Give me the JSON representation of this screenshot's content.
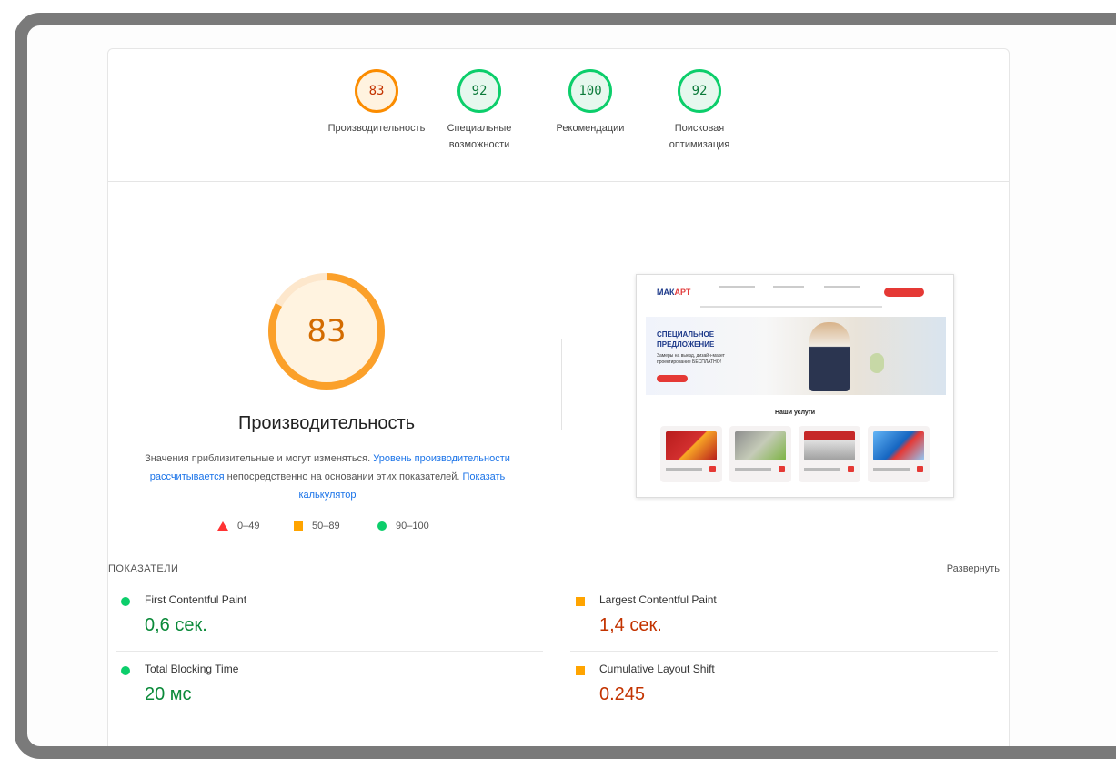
{
  "categories": [
    {
      "score": "83",
      "label": "Производительность",
      "status": "average"
    },
    {
      "score": "92",
      "label": "Специальные возможности",
      "status": "pass"
    },
    {
      "score": "100",
      "label": "Рекомендации",
      "status": "pass"
    },
    {
      "score": "92",
      "label": "Поисковая оптимизация",
      "status": "pass"
    }
  ],
  "performance": {
    "score": "83",
    "score_fraction": 0.83,
    "title": "Производительность",
    "desc_part1": "Значения приблизительные и могут изменяться. ",
    "desc_link1": "Уровень производительности рассчитывается",
    "desc_part2": " непосредственно на основании этих показателей. ",
    "desc_link2": "Показать калькулятор"
  },
  "legend": [
    {
      "range": "0–49",
      "shape": "triangle",
      "color": "#ff3333"
    },
    {
      "range": "50–89",
      "shape": "square",
      "color": "#ffa400"
    },
    {
      "range": "90–100",
      "shape": "circle",
      "color": "#0cce6b"
    }
  ],
  "thumbnail": {
    "logo_main": "МАК",
    "logo_accent": "АРТ",
    "hero_title": "СПЕЦИАЛЬНОЕ ПРЕДЛОЖЕНИЕ",
    "hero_sub": "Замеры на выезд, дизайн-макет проектирование БЕСПЛАТНО!",
    "services_title": "Наши услуги"
  },
  "metrics_header": {
    "title": "ПОКАЗАТЕЛИ",
    "expand": "Развернуть"
  },
  "metrics": [
    {
      "name": "First Contentful Paint",
      "value": "0,6 сек.",
      "status": "pass"
    },
    {
      "name": "Largest Contentful Paint",
      "value": "1,4 сек.",
      "status": "average"
    },
    {
      "name": "Total Blocking Time",
      "value": "20 мс",
      "status": "pass"
    },
    {
      "name": "Cumulative Layout Shift",
      "value": "0.245",
      "status": "average"
    }
  ],
  "colors": {
    "pass": "#0cce6b",
    "average": "#ffa400",
    "fail": "#ff3333"
  }
}
